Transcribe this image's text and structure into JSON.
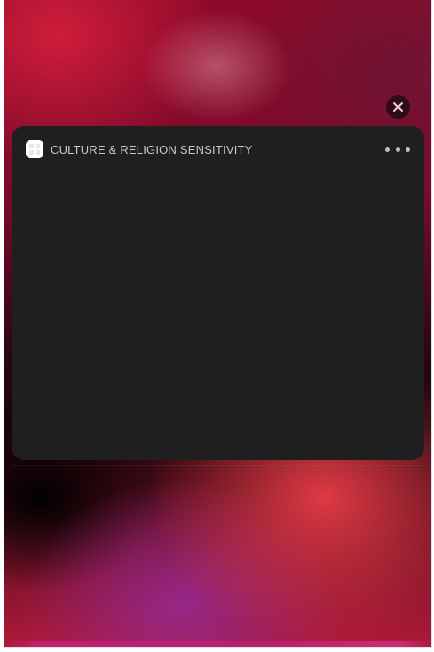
{
  "widget": {
    "title": "CULTURE & RELIGION SENSITIVITY",
    "app_icon": "app-grid-icon",
    "more_icon": "ellipsis-icon"
  },
  "close_icon": "close-icon",
  "colors": {
    "card_background": "#1f1f20",
    "title_text": "#c7c7c9",
    "close_button_background": "#2a0c16",
    "close_glyph": "#f3c8d2"
  }
}
